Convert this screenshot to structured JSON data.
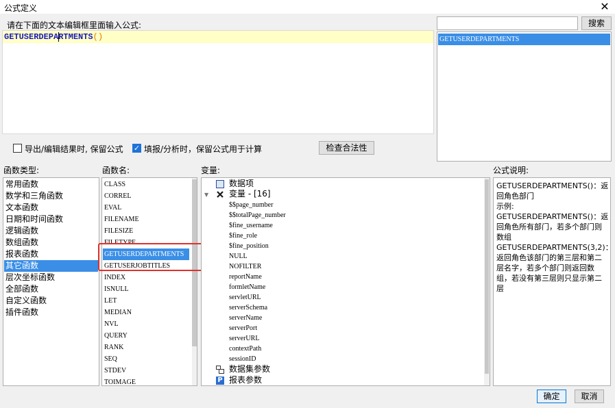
{
  "window": {
    "title": "公式定义",
    "close_glyph": "✕"
  },
  "editor": {
    "prompt": "请在下面的文本编辑框里面输入公式:",
    "formula_name": "GETUSERDEPARTMENTS",
    "formula_parens": "()"
  },
  "search": {
    "value": "",
    "button_label": "搜索",
    "results": [
      "GETUSERDEPARTMENTS"
    ]
  },
  "options": {
    "keep_formula_export": {
      "label": "导出/编辑结果时, 保留公式",
      "checked": false
    },
    "keep_formula_fill": {
      "label": "填报/分析时，保留公式用于计算",
      "checked": true,
      "glyph": "✓"
    },
    "check_button_label": "检查合法性"
  },
  "categories": {
    "header": "函数类型:",
    "items": [
      "常用函数",
      "数学和三角函数",
      "文本函数",
      "日期和时间函数",
      "逻辑函数",
      "数组函数",
      "报表函数",
      "其它函数",
      "层次坐标函数",
      "全部函数",
      "自定义函数",
      "插件函数"
    ],
    "selected": "其它函数"
  },
  "functions": {
    "header": "函数名:",
    "items": [
      "CLASS",
      "CORREL",
      "EVAL",
      "FILENAME",
      "FILESIZE",
      "FILETYPE",
      "GETUSERDEPARTMENTS",
      "GETUSERJOBTITLES",
      "INDEX",
      "ISNULL",
      "LET",
      "MEDIAN",
      "NVL",
      "QUERY",
      "RANK",
      "SEQ",
      "STDEV",
      "TOIMAGE"
    ],
    "selected": "GETUSERDEPARTMENTS"
  },
  "variables": {
    "header": "变量:",
    "data_items_label": "数据项",
    "variables_label": "变量 - [16]",
    "expand_glyph": "▼",
    "variable_items": [
      "$$page_number",
      "$$totalPage_number",
      "$fine_username",
      "$fine_role",
      "$fine_position",
      "NULL",
      "NOFILTER",
      "reportName",
      "formletName",
      "servletURL",
      "serverSchema",
      "serverName",
      "serverPort",
      "serverURL",
      "contextPath",
      "sessionID"
    ],
    "dataset_params_label": "数据集参数",
    "report_params_label": "报表参数",
    "report_params_icon_glyph": "P",
    "icons": [
      "table-icon",
      "variable-x-icon",
      "dataset-param-icon",
      "report-param-icon"
    ]
  },
  "description": {
    "header": "公式说明:",
    "lines": [
      "GETUSERDEPARTMENTS()：返回角色部门",
      "示例:",
      "GETUSERDEPARTMENTS()：返回角色所有部门，若多个部门则数组",
      "GETUSERDEPARTMENTS(3,2)：返回角色该部门的第三层和第二层名字，若多个部门则返回数组，若没有第三层则只显示第二层"
    ]
  },
  "footer": {
    "ok_label": "确定",
    "cancel_label": "取消"
  },
  "colors": {
    "selection": "#3a8ee6",
    "highlight_box": "#e0302a",
    "formula_text": "#1a1ab8",
    "formula_parens": "#e07800",
    "editor_line": "#ffffc6"
  }
}
